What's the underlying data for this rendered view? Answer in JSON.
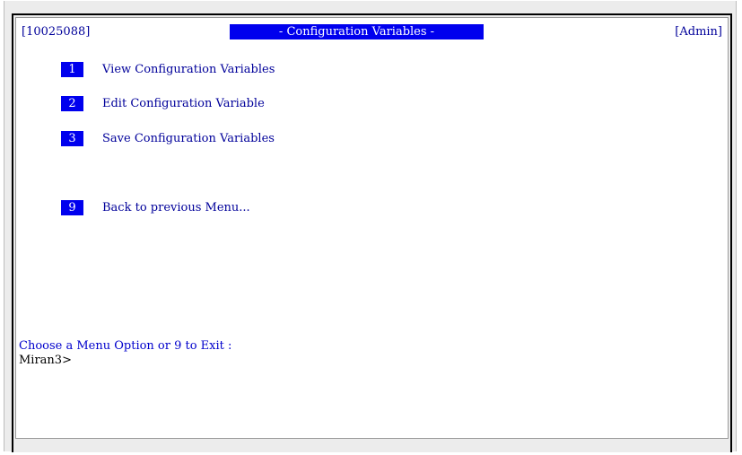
{
  "header": {
    "id": "[10025088]",
    "title": "- Configuration Variables -",
    "role": "[Admin]"
  },
  "menu": [
    {
      "key": "1",
      "label": "View Configuration Variables"
    },
    {
      "key": "2",
      "label": "Edit Configuration Variable"
    },
    {
      "key": "3",
      "label": "Save Configuration Variables"
    },
    {
      "key": "9",
      "label": "Back to previous Menu..."
    }
  ],
  "prompt": "Choose a Menu Option or 9 to Exit :",
  "shell_prompt": "Miran3>",
  "colors": {
    "text": "#00009a",
    "highlight": "#0000ee",
    "highlight_text": "#ffffff",
    "background": "#ffffff"
  }
}
